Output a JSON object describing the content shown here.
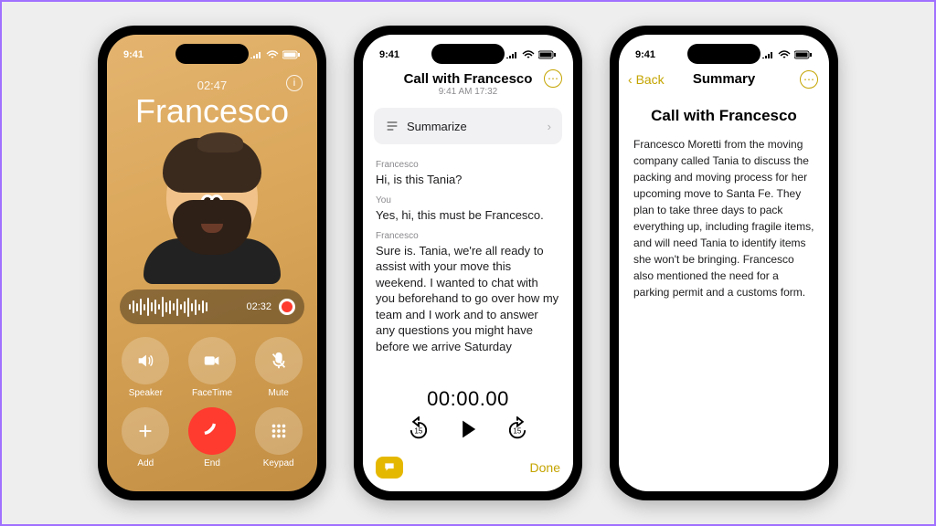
{
  "status": {
    "time": "9:41"
  },
  "call": {
    "duration_top": "02:47",
    "name": "Francesco",
    "record_time": "02:32",
    "controls": {
      "speaker": "Speaker",
      "facetime": "FaceTime",
      "mute": "Mute",
      "add": "Add",
      "end": "End",
      "keypad": "Keypad"
    }
  },
  "transcript": {
    "title": "Call with Francesco",
    "subtitle": "9:41 AM  17:32",
    "summarize_label": "Summarize",
    "lines": [
      {
        "speaker": "Francesco",
        "text": "Hi, is this Tania?"
      },
      {
        "speaker": "You",
        "text": "Yes, hi, this must be Francesco."
      },
      {
        "speaker": "Francesco",
        "text": "Sure is. Tania, we're all ready to assist with your move this weekend. I wanted to chat with you beforehand to go over how my team and I work and to answer any questions you might have before we arrive Saturday"
      }
    ],
    "timer": "00:00.00",
    "done": "Done"
  },
  "summary": {
    "back": "Back",
    "nav_title": "Summary",
    "doc_title": "Call with Francesco",
    "body": "Francesco Moretti from the moving company called Tania to discuss the packing and moving process for her upcoming move to Santa Fe. They plan to take three days to pack everything up, including fragile items, and will need Tania to identify items she won't be bringing. Francesco also mentioned the need for a parking permit and a customs form."
  }
}
